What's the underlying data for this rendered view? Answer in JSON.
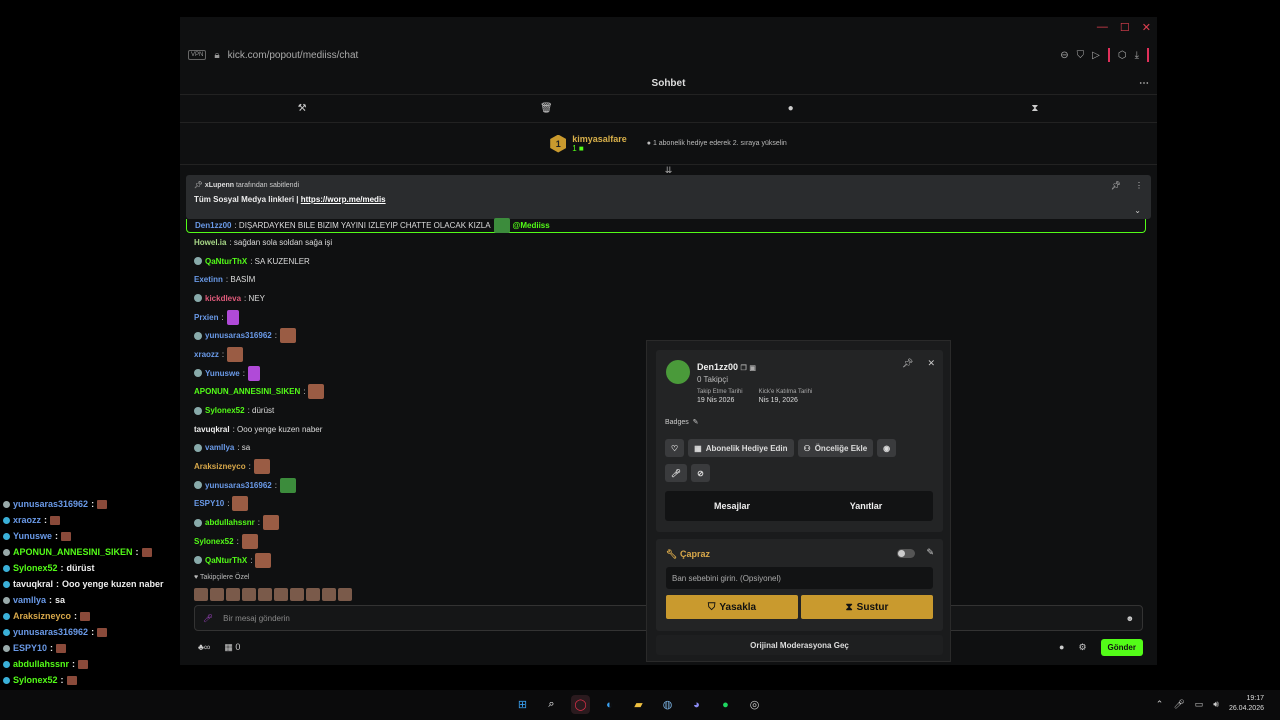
{
  "overlay": {
    "lines": [
      {
        "user": "yunusaras316962",
        "color": "#6a9ae8",
        "text": "",
        "emote": true
      },
      {
        "user": "xraozz",
        "color": "#6a9ae8",
        "text": "",
        "emote": true
      },
      {
        "user": "Yunuswe",
        "color": "#6a9ae8",
        "text": "",
        "emote": true
      },
      {
        "user": "APONUN_ANNESINI_SIKEN",
        "color": "#53fc18",
        "text": "",
        "emote": true
      },
      {
        "user": "Sylonex52",
        "color": "#53fc18",
        "text": "dürüst",
        "emote": false
      },
      {
        "user": "tavuqkral",
        "color": "#eee",
        "text": "Ooo yenge kuzen naber",
        "emote": false
      },
      {
        "user": "vamllya",
        "color": "#6a9ae8",
        "text": "sa",
        "emote": false
      },
      {
        "user": "Araksizneyco",
        "color": "#d8a84a",
        "text": "",
        "emote": true
      },
      {
        "user": "yunusaras316962",
        "color": "#6a9ae8",
        "text": "",
        "emote": true
      },
      {
        "user": "ESPY10",
        "color": "#6a9ae8",
        "text": "",
        "emote": true
      },
      {
        "user": "abdullahssnr",
        "color": "#53fc18",
        "text": "",
        "emote": true
      },
      {
        "user": "Sylonex52",
        "color": "#53fc18",
        "text": "",
        "emote": true
      },
      {
        "user": "QaNturThX",
        "color": "#53fc18",
        "text": "",
        "emote": true
      }
    ]
  },
  "browser": {
    "vpn": "VPN",
    "url": "kick.com/popout/mediiss/chat"
  },
  "chat": {
    "title": "Sohbet",
    "leader": {
      "rank": "1",
      "name": "kimyasalfare",
      "gifts": "1",
      "hint": "1 abonelik hediye ederek 2. sıraya yükselin"
    },
    "pinned": {
      "by_user": "xLupenn",
      "by_text": "tarafından sabitlendi",
      "message": "Tüm Sosyal Medya linkleri | ",
      "link": "https://worp.me/medis"
    },
    "messages": [
      {
        "user": "Den1zz00",
        "color": "#6a9ae8",
        "text": ": DIŞARDAYKEN BILE BIZIM YAYINI IZLEYIP CHATTE OLACAK KIZLA",
        "mention": "@Mediiss",
        "emote": "green"
      },
      {
        "user": "Howel.ia",
        "color": "#a8d888",
        "text": ": sağdan sola soldan sağa işi",
        "emote": ""
      },
      {
        "user": "QaNturThX",
        "color": "#53fc18",
        "text": ": SA KUZENLER",
        "emote": ""
      },
      {
        "user": "Exetinn",
        "color": "#6a9ae8",
        "text": ": BASİM",
        "emote": ""
      },
      {
        "user": "kickdleva",
        "color": "#e05a7a",
        "text": ": NEY",
        "emote": ""
      },
      {
        "user": "Prxien",
        "color": "#6a9ae8",
        "text": ":",
        "emote": "purple"
      },
      {
        "user": "yunusaras316962",
        "color": "#6a9ae8",
        "text": ":",
        "emote": "brown"
      },
      {
        "user": "xraozz",
        "color": "#6a9ae8",
        "text": ":",
        "emote": "brown"
      },
      {
        "user": "Yunuswe",
        "color": "#6a9ae8",
        "text": ":",
        "emote": "purple"
      },
      {
        "user": "APONUN_ANNESINI_SIKEN",
        "color": "#53fc18",
        "text": ":",
        "emote": "brown"
      },
      {
        "user": "Sylonex52",
        "color": "#53fc18",
        "text": ": dürüst",
        "emote": ""
      },
      {
        "user": "tavuqkral",
        "color": "#eee",
        "text": ": Ooo yenge kuzen naber",
        "emote": ""
      },
      {
        "user": "vamllya",
        "color": "#6a9ae8",
        "text": ": sa",
        "emote": ""
      },
      {
        "user": "Araksizneyco",
        "color": "#d8a84a",
        "text": ":",
        "emote": "brown"
      },
      {
        "user": "yunusaras316962",
        "color": "#6a9ae8",
        "text": ":",
        "emote": "green"
      },
      {
        "user": "ESPY10",
        "color": "#6a9ae8",
        "text": ":",
        "emote": "brown"
      },
      {
        "user": "abdullahssnr",
        "color": "#53fc18",
        "text": ":",
        "emote": "brown"
      },
      {
        "user": "Sylonex52",
        "color": "#53fc18",
        "text": ":",
        "emote": "brown"
      },
      {
        "user": "QaNturThX",
        "color": "#53fc18",
        "text": ":",
        "emote": "brown"
      }
    ],
    "followers_only": "Takipçilere Özel",
    "input_placeholder": "Bir mesaj gönderin",
    "viewer_count": "0",
    "send_label": "Gönder"
  },
  "user_card": {
    "name": "Den1zz00",
    "followers": "0 Takipçi",
    "follow_date_label": "Takip Etme Tarihi",
    "follow_date": "19 Nis 2026",
    "join_date_label": "Kick'e Katılma Tarihi",
    "join_date": "Nis 19, 2026",
    "badges_label": "Badges",
    "gift_sub_label": "Abonelik Hediye Edin",
    "priority_label": "Önceliğe Ekle",
    "tab_messages": "Mesajlar",
    "tab_replies": "Yanıtlar",
    "mod_title": "Çapraz",
    "reason_placeholder": "Ban sebebini girin. (Opsiyonel)",
    "ban_label": "Yasakla",
    "mute_label": "Sustur",
    "original_mod": "Orijinal Moderasyona Geç"
  },
  "taskbar": {
    "time": "19:17",
    "date": "26.04.2026"
  }
}
